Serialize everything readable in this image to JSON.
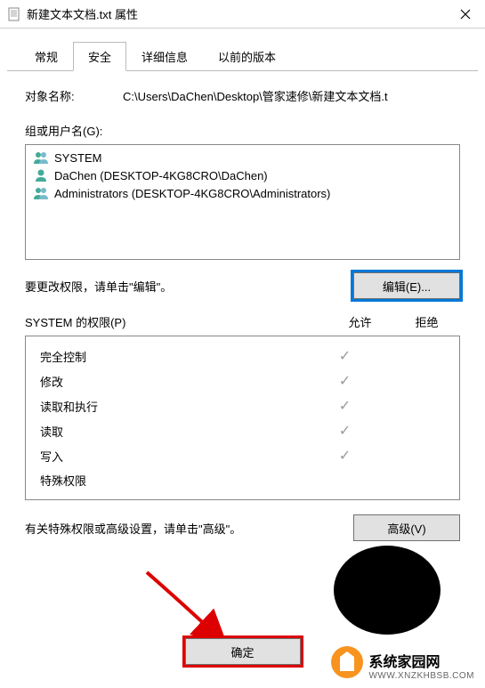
{
  "window": {
    "title": "新建文本文档.txt 属性"
  },
  "tabs": {
    "general": "常规",
    "security": "安全",
    "details": "详细信息",
    "previous": "以前的版本",
    "active": "security"
  },
  "object": {
    "label": "对象名称:",
    "value": "C:\\Users\\DaChen\\Desktop\\管家速修\\新建文本文档.t"
  },
  "groups": {
    "label": "组或用户名(G):",
    "items": [
      {
        "name": "SYSTEM",
        "iconType": "group-green"
      },
      {
        "name": "DaChen (DESKTOP-4KG8CRO\\DaChen)",
        "iconType": "user"
      },
      {
        "name": "Administrators (DESKTOP-4KG8CRO\\Administrators)",
        "iconType": "group-green"
      }
    ]
  },
  "editRow": {
    "text": "要更改权限，请单击\"编辑\"。",
    "button": "编辑(E)..."
  },
  "permissions": {
    "titlePrefix": "SYSTEM 的权限(P)",
    "allow": "允许",
    "deny": "拒绝",
    "rows": [
      {
        "name": "完全控制",
        "allow": true,
        "deny": false
      },
      {
        "name": "修改",
        "allow": true,
        "deny": false
      },
      {
        "name": "读取和执行",
        "allow": true,
        "deny": false
      },
      {
        "name": "读取",
        "allow": true,
        "deny": false
      },
      {
        "name": "写入",
        "allow": true,
        "deny": false
      },
      {
        "name": "特殊权限",
        "allow": false,
        "deny": false
      }
    ]
  },
  "advanced": {
    "text": "有关特殊权限或高级设置，请单击\"高级\"。",
    "button": "高级(V)"
  },
  "buttons": {
    "ok": "确定"
  },
  "watermark": {
    "cn": "系统家园网",
    "en": "WWW.XNZKHBSB.COM"
  }
}
